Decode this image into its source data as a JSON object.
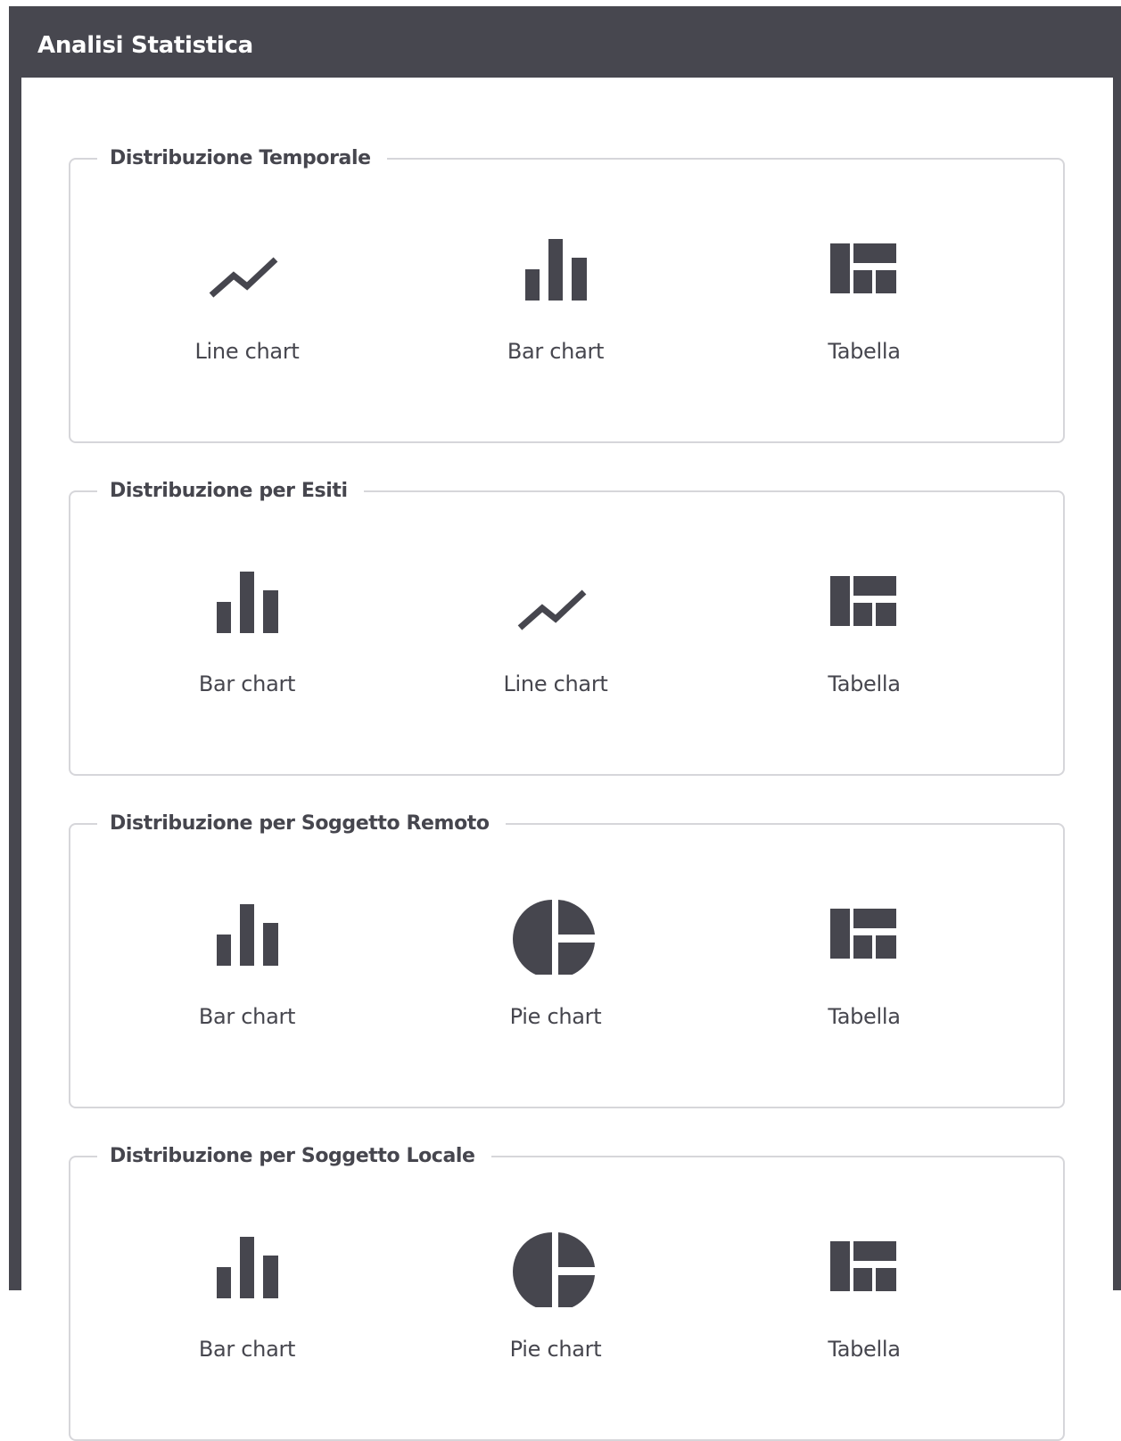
{
  "panel": {
    "title": "Analisi Statistica"
  },
  "colors": {
    "header": "#47474f",
    "icon": "#46464e",
    "border": "#d6d6da"
  },
  "sections": [
    {
      "legend": "Distribuzione Temporale",
      "options": [
        {
          "label": "Line chart",
          "icon": "line-chart-icon"
        },
        {
          "label": "Bar chart",
          "icon": "bar-chart-icon"
        },
        {
          "label": "Tabella",
          "icon": "table-icon"
        }
      ]
    },
    {
      "legend": "Distribuzione per Esiti",
      "options": [
        {
          "label": "Bar chart",
          "icon": "bar-chart-icon"
        },
        {
          "label": "Line chart",
          "icon": "line-chart-icon"
        },
        {
          "label": "Tabella",
          "icon": "table-icon"
        }
      ]
    },
    {
      "legend": "Distribuzione per Soggetto Remoto",
      "options": [
        {
          "label": "Bar chart",
          "icon": "bar-chart-icon"
        },
        {
          "label": "Pie chart",
          "icon": "pie-chart-icon"
        },
        {
          "label": "Tabella",
          "icon": "table-icon"
        }
      ]
    },
    {
      "legend": "Distribuzione per Soggetto Locale",
      "options": [
        {
          "label": "Bar chart",
          "icon": "bar-chart-icon"
        },
        {
          "label": "Pie chart",
          "icon": "pie-chart-icon"
        },
        {
          "label": "Tabella",
          "icon": "table-icon"
        }
      ]
    }
  ]
}
